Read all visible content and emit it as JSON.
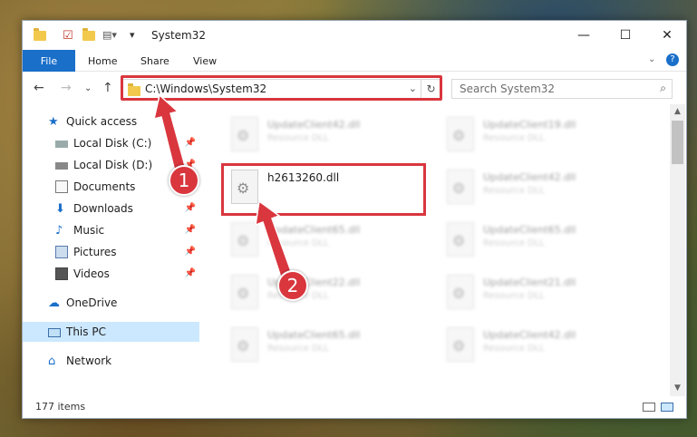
{
  "window": {
    "title": "System32",
    "controls": {
      "minimize": "—",
      "maximize": "☐",
      "close": "✕"
    }
  },
  "ribbon": {
    "tabs": [
      "File",
      "Home",
      "Share",
      "View"
    ]
  },
  "nav": {
    "address": "C:\\Windows\\System32",
    "search_placeholder": "Search System32"
  },
  "sidebar": {
    "items": [
      {
        "label": "Quick access",
        "icon": "star-icon",
        "pinned": false
      },
      {
        "label": "Local Disk (C:)",
        "icon": "drive-icon",
        "pinned": true
      },
      {
        "label": "Local Disk (D:)",
        "icon": "drive-icon",
        "pinned": true
      },
      {
        "label": "Documents",
        "icon": "documents-icon",
        "pinned": true
      },
      {
        "label": "Downloads",
        "icon": "downloads-icon",
        "pinned": true
      },
      {
        "label": "Music",
        "icon": "music-icon",
        "pinned": true
      },
      {
        "label": "Pictures",
        "icon": "pictures-icon",
        "pinned": true
      },
      {
        "label": "Videos",
        "icon": "videos-icon",
        "pinned": true
      },
      {
        "label": "OneDrive",
        "icon": "onedrive-icon",
        "pinned": false
      },
      {
        "label": "This PC",
        "icon": "pc-icon",
        "pinned": false
      },
      {
        "label": "Network",
        "icon": "network-icon",
        "pinned": false
      }
    ]
  },
  "files": {
    "left": [
      {
        "name": "UpdateClient42.dll",
        "desc": "Resource DLL"
      },
      {
        "name": "h2613260.dll",
        "desc": ""
      },
      {
        "name": "UpdateClient65.dll",
        "desc": "Resource DLL"
      },
      {
        "name": "UpdateClient22.dll",
        "desc": "Resource DLL"
      },
      {
        "name": "UpdateClient65.dll",
        "desc": "Resource DLL"
      }
    ],
    "right": [
      {
        "name": "UpdateClient19.dll",
        "desc": "Resource DLL"
      },
      {
        "name": "UpdateClient42.dll",
        "desc": "Resource DLL"
      },
      {
        "name": "UpdateClient65.dll",
        "desc": "Resource DLL"
      },
      {
        "name": "UpdateClient21.dll",
        "desc": "Resource DLL"
      },
      {
        "name": "UpdateClient42.dll",
        "desc": "Resource DLL"
      }
    ]
  },
  "status": {
    "item_count": "177 items"
  },
  "markers": {
    "step1": "1",
    "step2": "2"
  },
  "colors": {
    "accent": "#1a6fc9",
    "highlight": "#d9363e",
    "selected": "#cce8ff"
  }
}
